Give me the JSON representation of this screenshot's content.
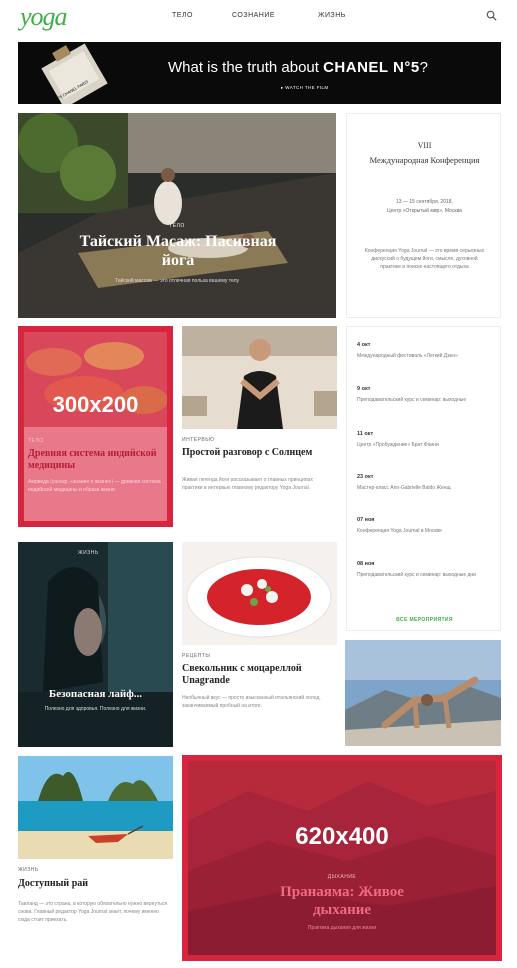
{
  "header": {
    "logo": "yoga",
    "nav": [
      "ТЕЛО",
      "СОЗНАНИЕ",
      "ЖИЗНЬ"
    ]
  },
  "banner": {
    "text_prefix": "What is the truth about ",
    "brand": "CHANEL N°5",
    "suffix": "?",
    "cta": "▸ WATCH THE FILM",
    "bottle_label": "N°5 CHANEL PARIS"
  },
  "hero": {
    "tag": "ТЕЛО",
    "title": "Тайский Масаж: Пасивная йога",
    "excerpt": "Тайский массаж — это отличная польза вашему телу"
  },
  "conference": {
    "roman": "VIII",
    "title": "Международная Конференция",
    "dates": "13 — 15 сентября, 2018,",
    "venue": "Центр «Открытый мир», Москва",
    "description": "Конференция Yoga Journal — это время серьезных дискуссий о будущем йоги, смысле, духовной практике и поиске настоящего отдыха"
  },
  "ad_small": {
    "label": "300x200",
    "tag": "ТЕЛО",
    "title": "Древняя система индийской медицины",
    "excerpt": "Аюрведа (санскр. «знание о жизни») — древняя система индийской медицины и образа жизни."
  },
  "sun_article": {
    "tag": "ИНТЕРВЬЮ",
    "title": "Простой разговор с Солнцем",
    "excerpt": "Живая легенда йоги рассказывает о главных принципах практики в интервью главному редактору Yoga Journal."
  },
  "events": {
    "items": [
      {
        "date": "4 окт",
        "text": "Международный фестиваль «Легкий Дзен»"
      },
      {
        "date": "9 окт",
        "text": "Преподавательский курс и семинар: выходные"
      },
      {
        "date": "11 окт",
        "text": "Центр «Пробуждение» Брат Фанни"
      },
      {
        "date": "23 окт",
        "text": "Мастер-класс Ann-Gabrielle Baldo Женщ"
      },
      {
        "date": "07 ноя",
        "text": "Конференция Yoga Journal в Москве"
      },
      {
        "date": "08 ноя",
        "text": "Преподавательский курс и семинар: выходные дни"
      }
    ],
    "all_link": "ВСЕ МЕРОПРИЯТИЯ"
  },
  "woman_card": {
    "tag": "ЖИЗНЬ",
    "title": "Безопасная лайф...",
    "excerpt": "Полезно для здоровья. Полезно для жизни."
  },
  "soup_article": {
    "tag": "РЕЦЕПТЫ",
    "title": "Свекольник с моцареллой Unagrande",
    "excerpt": "Необычный вкус — просто изысканный итальянский холод, заканчиваемый пробный на итоге."
  },
  "beach_article": {
    "tag": "ЖИЗНЬ",
    "title": "Доступный рай",
    "excerpt": "Таиланд — это страна, в которую обязательно нужно вернуться снова. Главный редактор Yoga Journal знает, почему именно сюда стоит приехать."
  },
  "ad_large": {
    "label": "620x400",
    "tag": "ДЫХАНИЕ",
    "title": "Пранаяма: Живое дыхание",
    "excerpt": "Практика дыхания для жизни"
  },
  "colors": {
    "accent": "#3fae49",
    "ad_red": "#d8253f"
  },
  "icons": {
    "search": "search-icon"
  }
}
